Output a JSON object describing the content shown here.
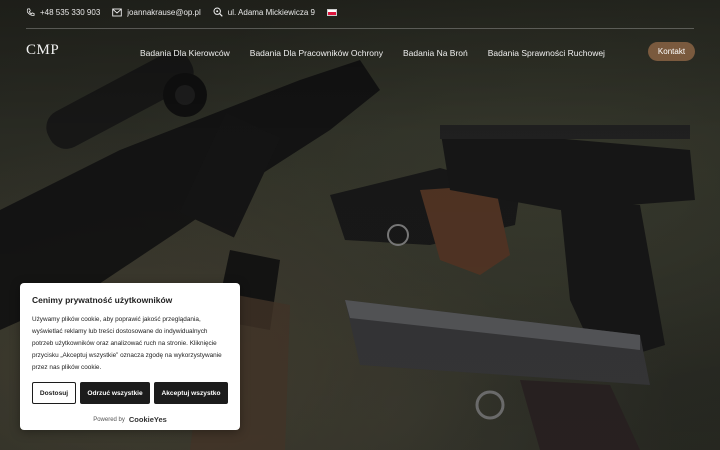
{
  "topbar": {
    "phone": "+48 535 330 903",
    "email": "joannakrause@op.pl",
    "address": "ul. Adama Mickiewicza 9"
  },
  "header": {
    "logo": "CMP",
    "nav": [
      "Badania Dla Kierowców",
      "Badania Dla Pracowników Ochrony",
      "Badania Na Broń",
      "Badania Sprawności Ruchowej"
    ],
    "cta": "Kontakt"
  },
  "cookie": {
    "title": "Cenimy prywatność użytkowników",
    "body": "Używamy plików cookie, aby poprawić jakość przeglądania, wyświetlać reklamy lub treści dostosowane do indywidualnych potrzeb użytkowników oraz analizować ruch na stronie. Kliknięcie przycisku „Akceptuj wszystkie” oznacza zgodę na wykorzystywanie przez nas plików cookie.",
    "buttons": {
      "customize": "Dostosuj",
      "reject": "Odrzuć wszystkie",
      "accept": "Akceptuj wszystko"
    },
    "powered_by": "Powered by",
    "brand": "CookieYes"
  },
  "colors": {
    "accent": "#7a5a3e",
    "dark_button": "#1c1c1c"
  }
}
